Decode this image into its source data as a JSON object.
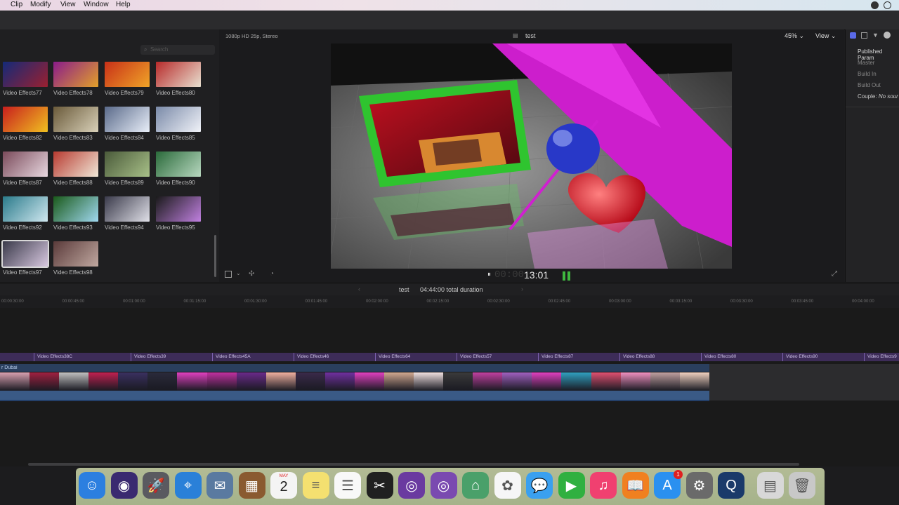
{
  "menu": {
    "items": [
      "Clip",
      "Modify",
      "View",
      "Window",
      "Help"
    ]
  },
  "browser": {
    "search_placeholder": "Search",
    "clips": [
      {
        "label": "Video Effects77",
        "colors": [
          "#142a78",
          "#9a2030"
        ]
      },
      {
        "label": "Video Effects78",
        "colors": [
          "#8a1c8a",
          "#e2a02a"
        ]
      },
      {
        "label": "Video Effects79",
        "colors": [
          "#c83018",
          "#f0a428"
        ]
      },
      {
        "label": "Video Effects80",
        "colors": [
          "#b82a2a",
          "#e8e0d0"
        ]
      },
      {
        "label": "Video Effects82",
        "colors": [
          "#c81e1e",
          "#f0c020"
        ]
      },
      {
        "label": "Video Effects83",
        "colors": [
          "#6a5a3a",
          "#d8d0b8"
        ]
      },
      {
        "label": "Video Effects84",
        "colors": [
          "#5a6a8a",
          "#e8eef8"
        ]
      },
      {
        "label": "Video Effects85",
        "colors": [
          "#7a8aa8",
          "#f0f2f8"
        ]
      },
      {
        "label": "Video Effects87",
        "colors": [
          "#7a4a5a",
          "#e8d8e0"
        ]
      },
      {
        "label": "Video Effects88",
        "colors": [
          "#b83a30",
          "#f0e8d8"
        ]
      },
      {
        "label": "Video Effects89",
        "colors": [
          "#4a5a3a",
          "#a8c088"
        ]
      },
      {
        "label": "Video Effects90",
        "colors": [
          "#2a6a3a",
          "#b8d8c0"
        ]
      },
      {
        "label": "Video Effects92",
        "colors": [
          "#2a7a8a",
          "#d0e8f0"
        ]
      },
      {
        "label": "Video Effects93",
        "colors": [
          "#1a5a1a",
          "#a0d8f0"
        ]
      },
      {
        "label": "Video Effects94",
        "colors": [
          "#3a3a4a",
          "#e0e0e8"
        ]
      },
      {
        "label": "Video Effects95",
        "colors": [
          "#1a1a1a",
          "#c080e0"
        ]
      },
      {
        "label": "Video Effects97",
        "colors": [
          "#3a3a4a",
          "#d8c8e0"
        ]
      },
      {
        "label": "Video Effects98",
        "colors": [
          "#5a3a3a",
          "#c0a8a0"
        ]
      }
    ]
  },
  "viewer": {
    "format": "1080p HD 25p, Stereo",
    "project_title": "test",
    "zoom": "45%",
    "view_menu": "View",
    "timecode_dim": "00:00:",
    "timecode": "13:01"
  },
  "inspector": {
    "items": [
      "Published Param",
      "Master",
      "Build In",
      "Build Out"
    ],
    "couple_label": "Couple:",
    "couple_value": "No sour"
  },
  "timeline": {
    "project_name": "test",
    "duration": "04:44:00 total duration",
    "ruler_ticks": [
      "00:00:30:00",
      "00:00:45:00",
      "00:01:00:00",
      "00:01:15:00",
      "00:01:30:00",
      "00:01:45:00",
      "00:02:00:00",
      "00:02:15:00",
      "00:02:30:00",
      "00:02:45:00",
      "00:03:00:00",
      "00:03:15:00",
      "00:03:30:00",
      "00:03:45:00",
      "00:04:00:00"
    ],
    "title_clips": [
      "Video Effects38C",
      "Video Effects39",
      "Video Effects45A",
      "Video Effects46",
      "Video Effects64",
      "Video Effects57",
      "Video Effects87",
      "Video Effects88",
      "Video Effects80",
      "Video Effects90",
      "Video Effects9"
    ],
    "primary_label": "r Dubai",
    "film_colors": [
      "#d8a0b0",
      "#a02040",
      "#c0c0c0",
      "#c02050",
      "#3a3060",
      "#2a2a3a",
      "#e040c0",
      "#c030a0",
      "#6a2a8a",
      "#f0b0a0",
      "#3a2a4a",
      "#7030a0",
      "#e040c0",
      "#d0a890",
      "#f0e0e0",
      "#3a3a3a",
      "#c040a0",
      "#a060c0",
      "#e040c0",
      "#30a0c0",
      "#e05070",
      "#f090c0",
      "#c0a0a0",
      "#f0d0c0"
    ]
  },
  "dock": {
    "calendar_month": "MAY",
    "calendar_day": "2",
    "app_store_badge": "1",
    "apps": [
      "finder",
      "siri",
      "launchpad",
      "safari",
      "mail-bird",
      "notes-book",
      "calendar",
      "stickies",
      "reminders",
      "final-cut",
      "motion",
      "motion-2",
      "maps",
      "photos",
      "messages",
      "facetime",
      "itunes",
      "ibooks",
      "app-store",
      "system-preferences",
      "quicktime",
      "files",
      "trash"
    ]
  }
}
